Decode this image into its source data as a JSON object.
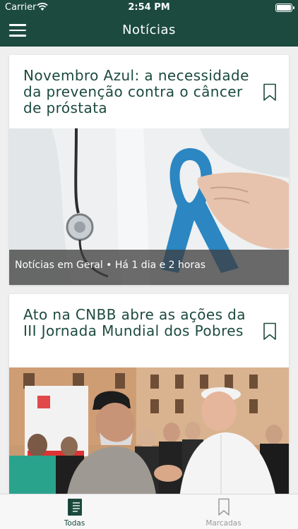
{
  "status_bar": {
    "carrier": "Carrier",
    "time": "2:54 PM"
  },
  "header": {
    "title": "Notícias",
    "menu_icon": "hamburger-menu-icon"
  },
  "articles": [
    {
      "title": "Novembro Azul: a necessidade da prevenção contra o câncer de próstata",
      "category": "Notícias em Geral",
      "separator": "•",
      "time_ago": "Há 1 dia e 2 horas",
      "image": "doctor-holding-blue-ribbon",
      "bookmark_icon": "bookmark-outline-icon"
    },
    {
      "title": "Ato na CNBB abre as ações da III Jornada Mundial dos Pobres",
      "image": "pope-greeting-elderly-man-crowd",
      "bookmark_icon": "bookmark-outline-icon"
    }
  ],
  "tabs": [
    {
      "label": "Todas",
      "icon": "book-icon",
      "active": true
    },
    {
      "label": "Marcadas",
      "icon": "bookmark-outline-icon",
      "active": false
    }
  ],
  "colors": {
    "primary": "#1c4a3f",
    "accent_ribbon": "#2b86c2",
    "inactive": "#9a9a9a"
  }
}
